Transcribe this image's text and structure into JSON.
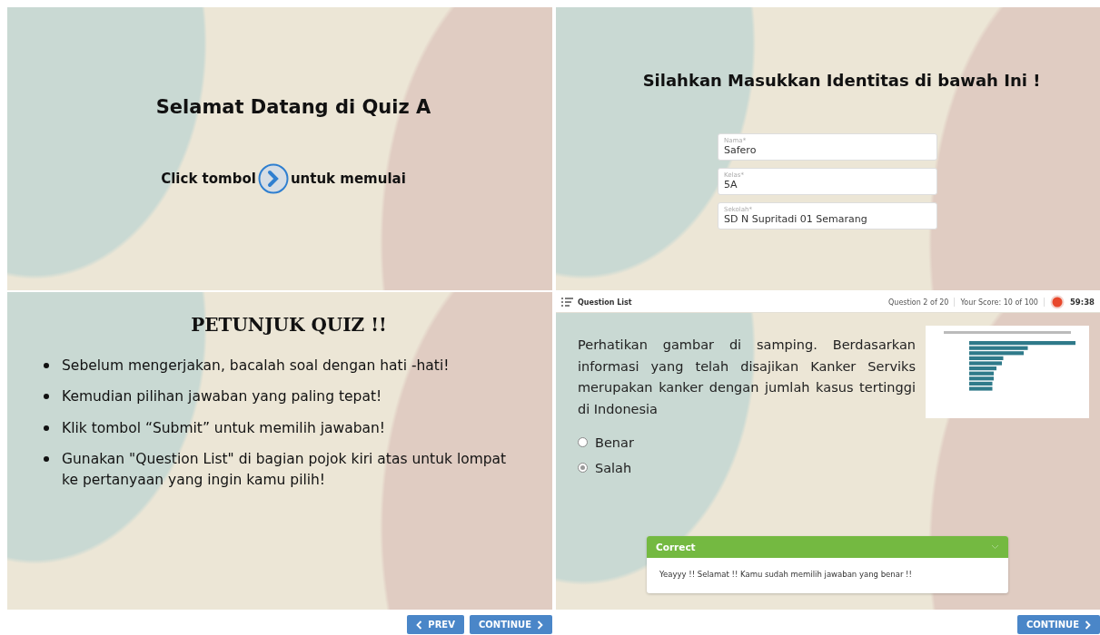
{
  "welcome": {
    "title": "Selamat Datang di Quiz A",
    "before": "Click tombol",
    "after": "untuk memulai"
  },
  "identity": {
    "title": "Silahkan Masukkan Identitas di bawah Ini !",
    "fields": [
      {
        "label": "Nama*",
        "value": "Safero"
      },
      {
        "label": "Kelas*",
        "value": "5A"
      },
      {
        "label": "Sekolah*",
        "value": "SD N Supritadi 01 Semarang"
      }
    ]
  },
  "instructions": {
    "title": "PETUNJUK QUIZ !!",
    "items": [
      "Sebelum mengerjakan, bacalah soal dengan hati -hati!",
      "Kemudian pilihan jawaban yang paling tepat!",
      "Klik tombol “Submit” untuk memilih jawaban!",
      "Gunakan \"Question List\" di bagian pojok kiri atas untuk lompat ke pertanyaan yang ingin kamu pilih!"
    ]
  },
  "left_nav": [
    {
      "kind": "prev",
      "label": "PREV"
    },
    {
      "kind": "next",
      "label": "CONTINUE"
    }
  ],
  "quiz": {
    "toolbar": {
      "menu": "Question List",
      "progress": "Question 2 of 20",
      "score": "Your Score: 10 of 100",
      "timer": "59:38"
    },
    "question": "Perhatikan gambar di samping. Berdasarkan informasi yang telah disajikan Kanker Serviks merupakan kanker dengan jumlah kasus tertinggi di Indonesia",
    "options": [
      {
        "label": "Benar",
        "selected": false
      },
      {
        "label": "Salah",
        "selected": true
      }
    ],
    "feedback": {
      "title": "Correct",
      "message": "Yeayyy !! Selamat !! Kamu sudah memilih jawaban yang benar !!"
    }
  },
  "right_nav": [
    {
      "kind": "next",
      "label": "CONTINUE"
    }
  ]
}
